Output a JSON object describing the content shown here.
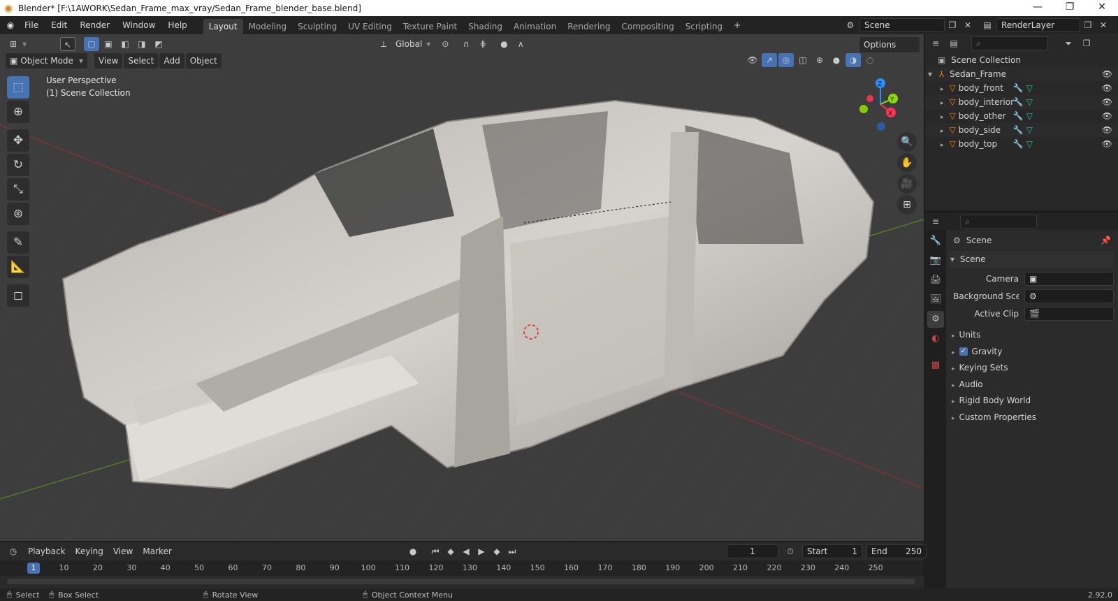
{
  "window": {
    "title": "Blender* [F:\\1AWORK\\Sedan_Frame_max_vray/Sedan_Frame_blender_base.blend]",
    "minimize_glyph": "—",
    "restore_glyph": "❐",
    "close_glyph": "✕"
  },
  "menubar": {
    "items": [
      "File",
      "Edit",
      "Render",
      "Window",
      "Help"
    ]
  },
  "workspaces": {
    "tabs": [
      "Layout",
      "Modeling",
      "Sculpting",
      "UV Editing",
      "Texture Paint",
      "Shading",
      "Animation",
      "Rendering",
      "Compositing",
      "Scripting"
    ],
    "active": "Layout",
    "add_glyph": "+"
  },
  "scene_selector": {
    "value": "Scene"
  },
  "layer_selector": {
    "value": "RenderLayer"
  },
  "tool_header": {
    "orientation": "Global",
    "options_label": "Options"
  },
  "viewport_header": {
    "mode": "Object Mode",
    "menus": [
      "View",
      "Select",
      "Add",
      "Object"
    ]
  },
  "viewport": {
    "perspective_label": "User Perspective",
    "collection_label": "(1) Scene Collection",
    "gizmo_axes": {
      "x": "X",
      "y": "Y",
      "z": "Z"
    }
  },
  "outliner": {
    "root": "Scene Collection",
    "collection": "Sedan_Frame",
    "objects": [
      "body_front",
      "body_interior",
      "body_other",
      "body_side",
      "body_top"
    ]
  },
  "properties": {
    "context_title": "Scene",
    "panel_title": "Scene",
    "camera_label": "Camera",
    "background_label": "Background Sce...",
    "active_clip_label": "Active Clip",
    "subpanels": [
      "Units",
      "Gravity",
      "Keying Sets",
      "Audio",
      "Rigid Body World",
      "Custom Properties"
    ],
    "gravity_checked": true
  },
  "timeline": {
    "menus": [
      "Playback",
      "Keying",
      "View",
      "Marker"
    ],
    "current_frame": "1",
    "start_label": "Start",
    "start_value": "1",
    "end_label": "End",
    "end_value": "250",
    "ruler": [
      "1",
      "10",
      "20",
      "30",
      "40",
      "50",
      "60",
      "70",
      "80",
      "90",
      "100",
      "110",
      "120",
      "130",
      "140",
      "150",
      "160",
      "170",
      "180",
      "190",
      "200",
      "210",
      "220",
      "230",
      "240",
      "250"
    ]
  },
  "statusbar": {
    "select": "Select",
    "box_select": "Box Select",
    "rotate_view": "Rotate View",
    "context_menu": "Object Context Menu",
    "version": "2.92.0"
  },
  "colors": {
    "accent_orange": "#e87d0d",
    "active_blue": "#4772b3",
    "axis_red": "#b73a3a",
    "axis_green": "#5b8d24",
    "gizmo_x": "#ff3352",
    "gizmo_y": "#8bdc00",
    "gizmo_z": "#2890ff",
    "mesh_icon_teal": "#20c0a0"
  }
}
